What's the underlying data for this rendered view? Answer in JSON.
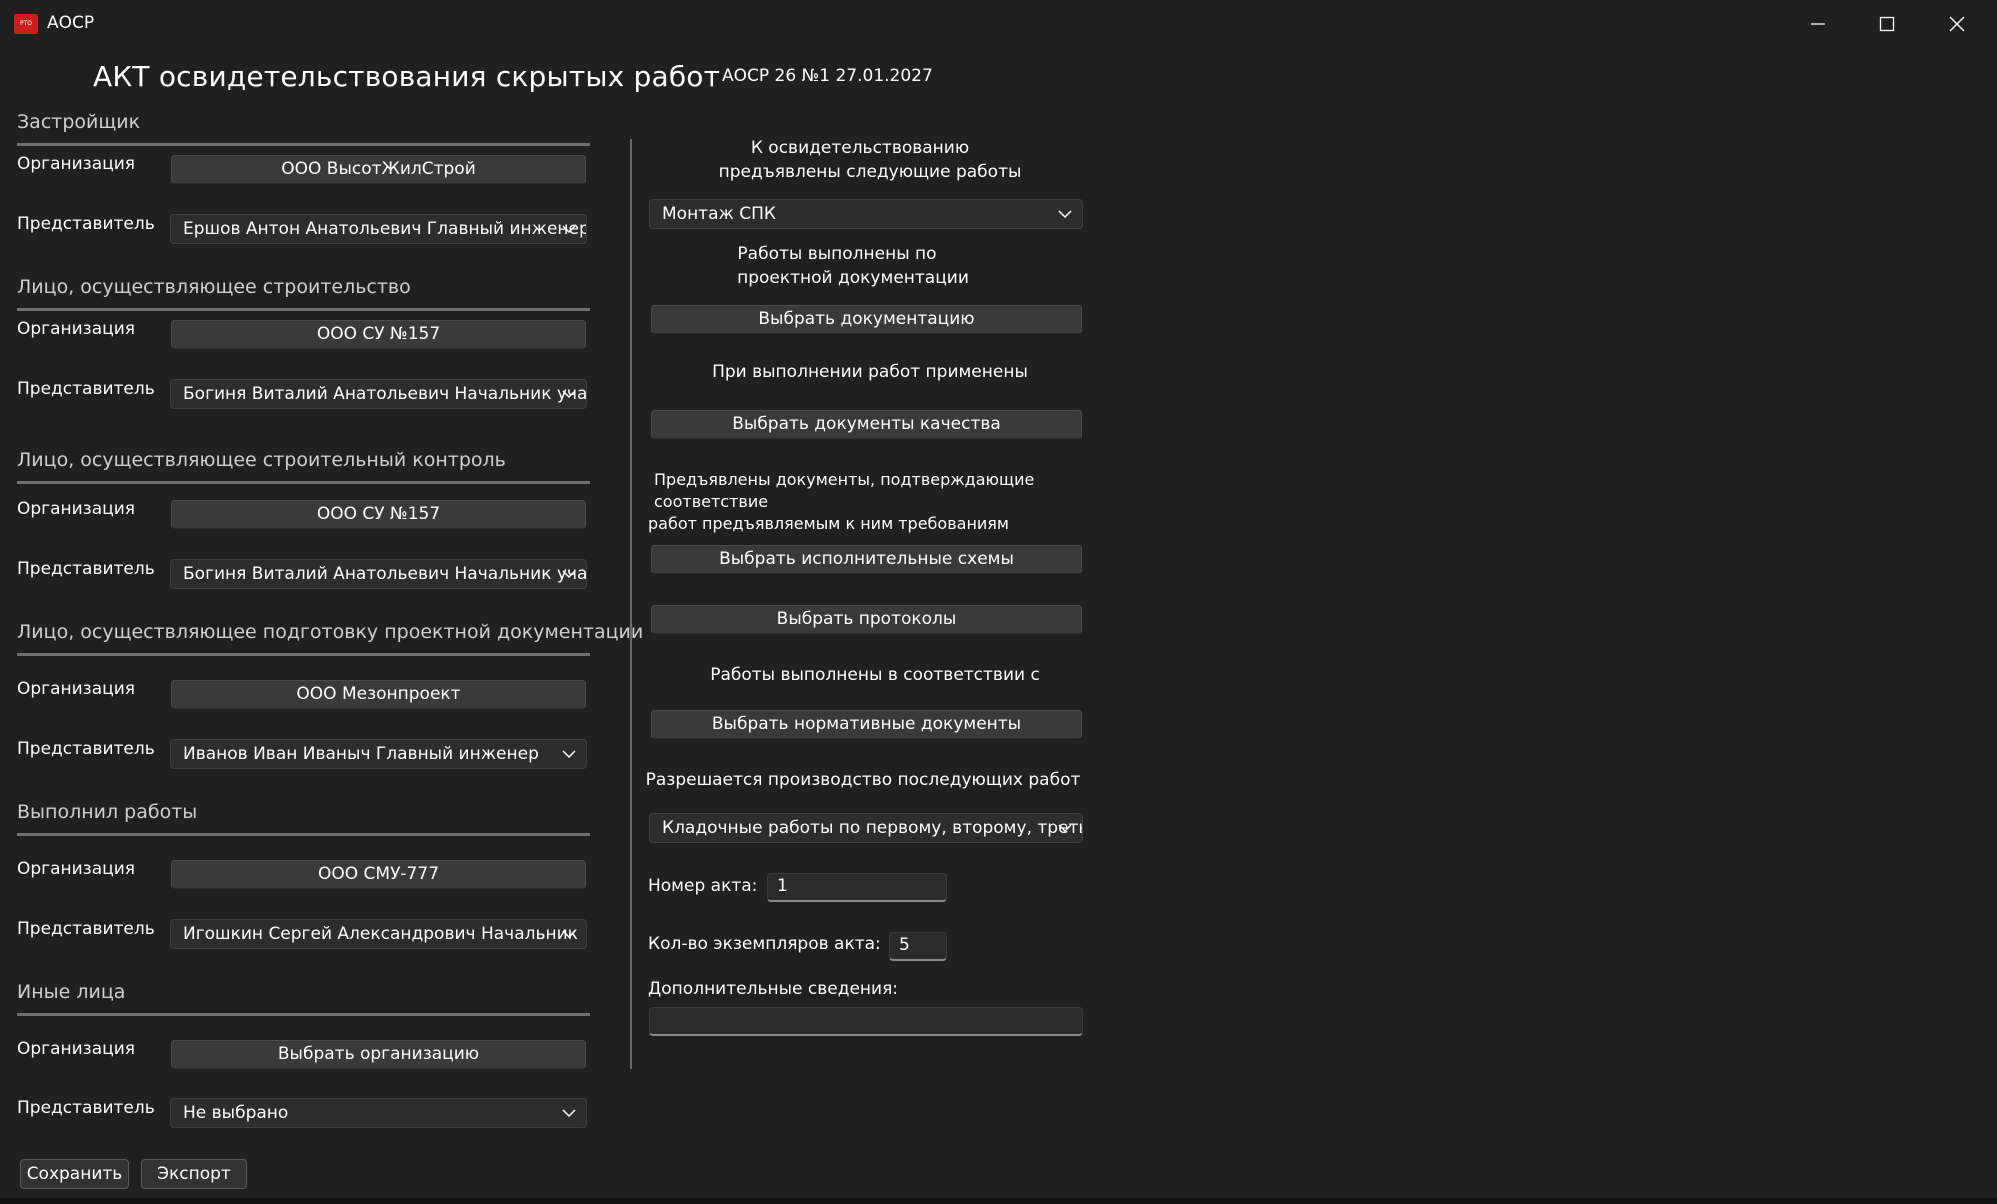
{
  "window": {
    "title": "АОСР",
    "app_icon_text": "РТО",
    "buttons": [
      "minimize-icon",
      "maximize-icon",
      "close-icon"
    ]
  },
  "header": {
    "title": "АКТ освидетельствования скрытых работ",
    "act_id": "АОСР 26 №1 27.01.2027"
  },
  "left": {
    "org_label": "Организация",
    "rep_label": "Представитель",
    "sections": [
      {
        "title": "Застройщик",
        "organization": "ООО ВысотЖилСтрой",
        "representative": "Ершов Антон Анатольевич Главный инженер"
      },
      {
        "title": "Лицо, осуществляющее строительство",
        "organization": "ООО СУ №157",
        "representative": "Богиня Виталий Анатольевич Начальник участка"
      },
      {
        "title": "Лицо, осуществляющее строительный контроль",
        "organization": "ООО СУ №157",
        "representative": "Богиня Виталий Анатольевич Начальник участка"
      },
      {
        "title": "Лицо, осуществляющее подготовку проектной документации",
        "organization": "ООО Мезонпроект",
        "representative": "Иванов Иван Иваныч Главный инженер"
      },
      {
        "title": "Выполнил работы",
        "organization": "ООО СМУ-777",
        "representative": "Игошкин Сергей Александрович Начальник"
      },
      {
        "title": "Иные лица",
        "organization": "Выбрать организацию",
        "representative": "Не выбрано"
      }
    ]
  },
  "right": {
    "works_label_1": "К освидетельствованию",
    "works_label_2": "предъявлены следующие работы",
    "works_combo": "Монтаж СПК",
    "project_label_1": "Работы выполнены по",
    "project_label_2": "проектной документации",
    "project_button": "Выбрать документацию",
    "materials_label": "При выполнении работ применены",
    "quality_button": "Выбрать документы качества",
    "docs_label_1": "Предъявлены документы, подтверждающие соответствие",
    "docs_label_2": "работ предъявляемым к ним требованиям",
    "schemes_button": "Выбрать исполнительные схемы",
    "protocols_button": "Выбрать протоколы",
    "norms_label": "Работы выполнены в соответствии с",
    "norms_button": "Выбрать нормативные документы",
    "next_label": "Разрешается производство последующих работ",
    "next_combo": "Кладочные работы по первому, второму, третьему этажам",
    "act_number_label": "Номер акта:",
    "act_number_value": "1",
    "copies_label": "Кол-во экземпляров акта:",
    "copies_value": "5",
    "extra_label": "Дополнительные сведения:",
    "extra_value": ""
  },
  "footer": {
    "save_label": "Сохранить",
    "export_label": "Экспорт"
  }
}
